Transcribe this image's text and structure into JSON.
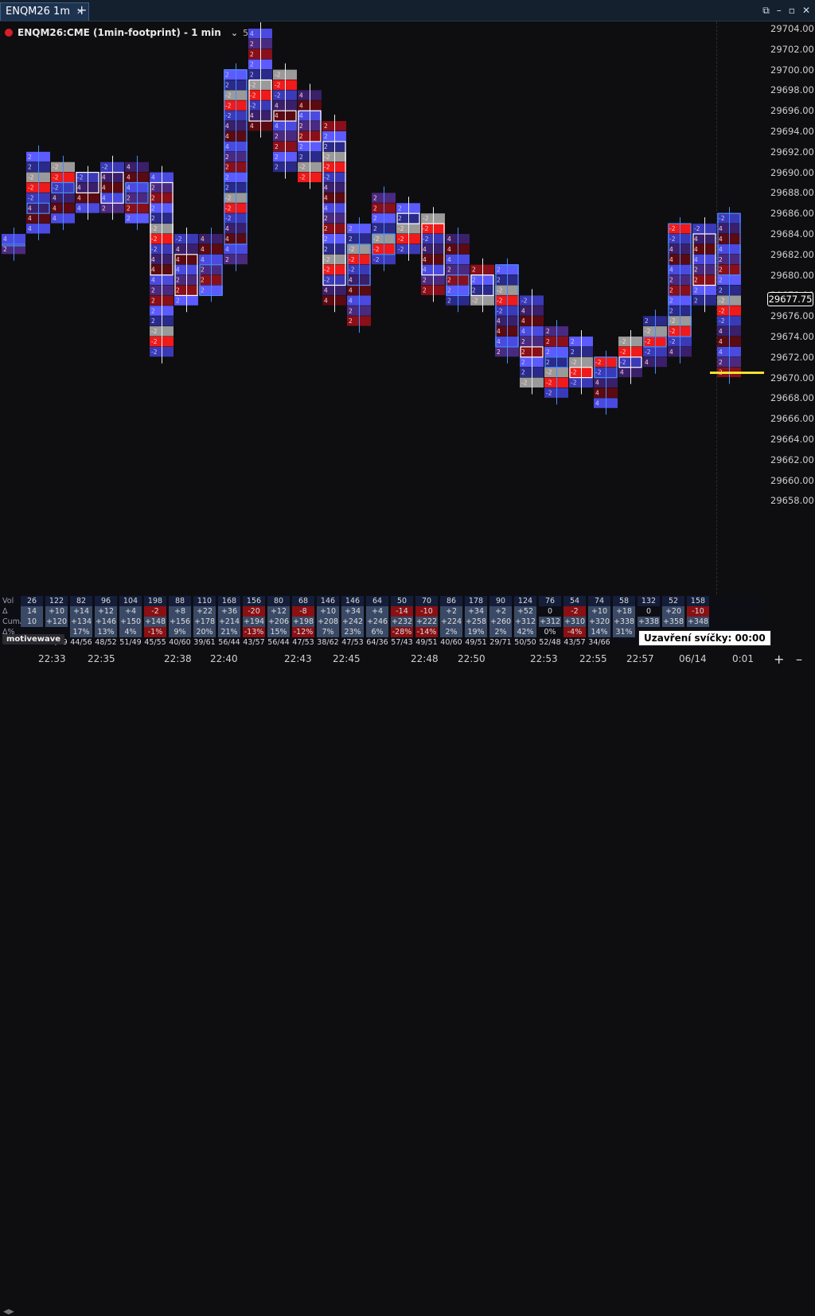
{
  "window": {
    "tab_title": "ENQM26 1m",
    "tab_close": "✕",
    "new_tab": "+",
    "controls": [
      "⧉",
      "–",
      "▫",
      "✕"
    ]
  },
  "chart_label": {
    "instrument": "ENQM26:CME (1min-footprint) - 1 min",
    "study_count": "5"
  },
  "price_axis": {
    "ticks": [
      "29704.00",
      "29702.00",
      "29700.00",
      "29698.00",
      "29696.00",
      "29694.00",
      "29692.00",
      "29690.00",
      "29688.00",
      "29686.00",
      "29684.00",
      "29682.00",
      "29680.00",
      "29678.00",
      "29676.00",
      "29674.00",
      "29672.00",
      "29670.00",
      "29668.00",
      "29666.00",
      "29664.00",
      "29662.00",
      "29660.00",
      "29658.00"
    ],
    "current_price": "29677.75"
  },
  "time_axis": {
    "labels": [
      "22:33",
      "22:35",
      "22:38",
      "22:40",
      "22:43",
      "22:45",
      "22:48",
      "22:50",
      "22:53",
      "22:55",
      "22:57",
      "06/14"
    ],
    "countdown": "0:01"
  },
  "stats": {
    "vol_label": "Vol",
    "delta_label": "Δ",
    "cum_label": "CumΔ",
    "ratio_label": "Δ%",
    "vol": [
      "26",
      "122",
      "82",
      "96",
      "104",
      "198",
      "88",
      "110",
      "168",
      "156",
      "80",
      "68",
      "146",
      "146",
      "64",
      "50",
      "70",
      "86",
      "178",
      "90",
      "124",
      "76",
      "54",
      "74",
      "58",
      "132",
      "52",
      "158"
    ],
    "delta": [
      "14",
      "+10",
      "+14",
      "+12",
      "+4",
      "-2",
      "+8",
      "+22",
      "+36",
      "-20",
      "+12",
      "-8",
      "+10",
      "+34",
      "+4",
      "-14",
      "-10",
      "+2",
      "+34",
      "+2",
      "+52",
      "0",
      "-2",
      "+10",
      "+18",
      "0",
      "+20",
      "-10"
    ],
    "cum": [
      "10",
      "+120",
      "+134",
      "+146",
      "+150",
      "+148",
      "+156",
      "+178",
      "+214",
      "+194",
      "+206",
      "+198",
      "+208",
      "+242",
      "+246",
      "+232",
      "+222",
      "+224",
      "+258",
      "+260",
      "+312",
      "+312",
      "+310",
      "+320",
      "+338",
      "+338",
      "+358",
      "+348"
    ],
    "pct": [
      "",
      "",
      "17%",
      "13%",
      "4%",
      "-1%",
      "9%",
      "20%",
      "21%",
      "-13%",
      "15%",
      "-12%",
      "7%",
      "23%",
      "6%",
      "-28%",
      "-14%",
      "2%",
      "19%",
      "2%",
      "42%",
      "0%",
      "-4%",
      "14%",
      "31%",
      "",
      "",
      ""
    ],
    "bidask": [
      "",
      "41/59",
      "44/56",
      "48/52",
      "51/49",
      "45/55",
      "40/60",
      "39/61",
      "56/44",
      "43/57",
      "56/44",
      "47/53",
      "38/62",
      "47/53",
      "64/36",
      "57/43",
      "49/51",
      "40/60",
      "49/51",
      "29/71",
      "50/50",
      "52/48",
      "43/57",
      "34/66",
      "",
      "",
      "",
      ""
    ]
  },
  "footer": {
    "brand": "motivewave",
    "candle_close": "Uzavření svíčky: 00:00",
    "zoom_in": "+",
    "zoom_out": "–"
  },
  "candles": [
    {
      "o": 29683,
      "h": 29684,
      "l": 29682,
      "c": 29683,
      "up": true
    },
    {
      "o": 29686,
      "h": 29692,
      "l": 29684,
      "c": 29687,
      "up": true
    },
    {
      "o": 29689,
      "h": 29691,
      "l": 29685,
      "c": 29688,
      "up": true
    },
    {
      "o": 29690,
      "h": 29690,
      "l": 29686,
      "c": 29688,
      "up": false
    },
    {
      "o": 29690,
      "h": 29691,
      "l": 29686,
      "c": 29687,
      "up": false
    },
    {
      "o": 29687,
      "h": 29691,
      "l": 29685,
      "c": 29689,
      "up": true
    },
    {
      "o": 29680,
      "h": 29690,
      "l": 29672,
      "c": 29689,
      "up": false
    },
    {
      "o": 29678,
      "h": 29684,
      "l": 29677,
      "c": 29682,
      "up": false
    },
    {
      "o": 29681,
      "h": 29684,
      "l": 29678,
      "c": 29678,
      "up": true
    },
    {
      "o": 29683,
      "h": 29700,
      "l": 29681,
      "c": 29700,
      "up": true
    },
    {
      "o": 29699,
      "h": 29704,
      "l": 29694,
      "c": 29695,
      "up": false
    },
    {
      "o": 29696,
      "h": 29700,
      "l": 29690,
      "c": 29695,
      "up": false
    },
    {
      "o": 29693,
      "h": 29698,
      "l": 29689,
      "c": 29696,
      "up": false
    },
    {
      "o": 29693,
      "h": 29695,
      "l": 29677,
      "c": 29679,
      "up": false
    },
    {
      "o": 29679,
      "h": 29685,
      "l": 29675,
      "c": 29683,
      "up": true
    },
    {
      "o": 29682,
      "h": 29688,
      "l": 29681,
      "c": 29684,
      "up": true
    },
    {
      "o": 29686,
      "h": 29687,
      "l": 29682,
      "c": 29685,
      "up": false
    },
    {
      "o": 29685,
      "h": 29686,
      "l": 29678,
      "c": 29680,
      "up": false
    },
    {
      "o": 29680,
      "h": 29684,
      "l": 29677,
      "c": 29678,
      "up": true
    },
    {
      "o": 29678,
      "h": 29681,
      "l": 29677,
      "c": 29680,
      "up": false
    },
    {
      "o": 29681,
      "h": 29681,
      "l": 29672,
      "c": 29673,
      "up": true
    },
    {
      "o": 29673,
      "h": 29678,
      "l": 29669,
      "c": 29672,
      "up": false
    },
    {
      "o": 29672,
      "h": 29675,
      "l": 29668,
      "c": 29671,
      "up": true
    },
    {
      "o": 29671,
      "h": 29674,
      "l": 29669,
      "c": 29670,
      "up": false
    },
    {
      "o": 29670,
      "h": 29672,
      "l": 29667,
      "c": 29672,
      "up": true
    },
    {
      "o": 29672,
      "h": 29674,
      "l": 29670,
      "c": 29671,
      "up": false
    },
    {
      "o": 29673,
      "h": 29676,
      "l": 29671,
      "c": 29674,
      "up": true
    },
    {
      "o": 29674,
      "h": 29685,
      "l": 29672,
      "c": 29685,
      "up": true
    },
    {
      "o": 29684,
      "h": 29685,
      "l": 29677,
      "c": 29679,
      "up": false
    },
    {
      "o": 29680,
      "h": 29686,
      "l": 29670,
      "c": 29686,
      "up": true
    }
  ]
}
